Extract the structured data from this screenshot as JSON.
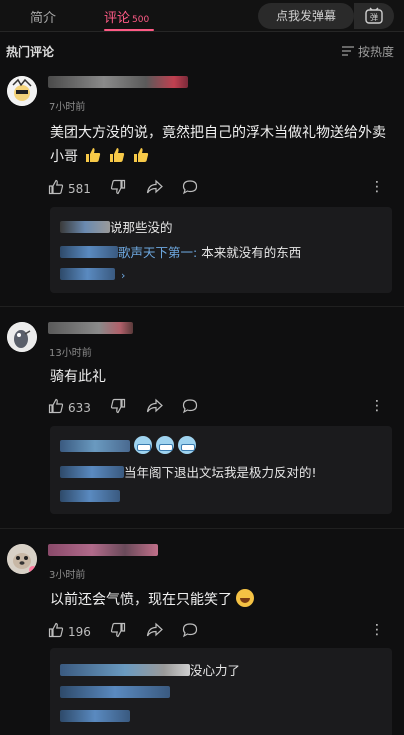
{
  "tabs": {
    "intro": "简介",
    "comments": "评论",
    "comments_count": "500",
    "danmaku_button": "点我发弹幕",
    "danmaku_icon": "弹"
  },
  "header": {
    "title": "热门评论",
    "sort_label": "按热度"
  },
  "comments": [
    {
      "time": "7小时前",
      "text": "美团大方没的说，竟然把自己的浮木当做礼物送给外卖小哥",
      "emoji": [
        "thumbs-up",
        "thumbs-up",
        "thumbs-up"
      ],
      "likes": "581",
      "replies": [
        {
          "text": "说那些没的"
        },
        {
          "name": "歌声天下第一:",
          "text": " 本来就没有的东西"
        }
      ]
    },
    {
      "time": "13小时前",
      "text": "骑有此礼",
      "likes": "633",
      "replies": [
        {
          "text": ""
        },
        {
          "text": "当年阁下退出文坛我是极力反对的!"
        }
      ]
    },
    {
      "time": "3小时前",
      "text": "以前还会气愤，现在只能笑了",
      "likes": "196",
      "replies": [
        {
          "text": "没心力了"
        }
      ]
    }
  ],
  "colors": {
    "accent": "#ff5b86",
    "reply_name": "#6ea8e0",
    "background": "#0f0f10"
  }
}
